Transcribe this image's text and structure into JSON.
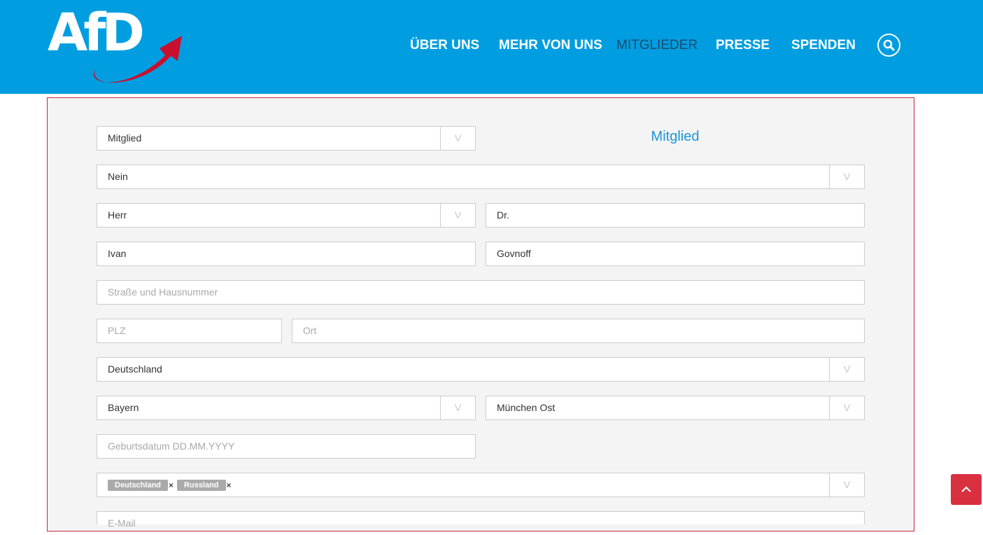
{
  "header": {
    "logo_text": "AfD",
    "nav": [
      {
        "label": "ÜBER UNS"
      },
      {
        "label": "MEHR VON UNS"
      },
      {
        "label": "MITGLIEDER"
      },
      {
        "label": "PRESSE"
      },
      {
        "label": "SPENDEN"
      }
    ],
    "search_icon": "search-icon"
  },
  "form": {
    "section_title": "Mitglied",
    "membership_type": {
      "value": "Mitglied"
    },
    "previously_member": {
      "value": "Nein"
    },
    "salutation": {
      "value": "Herr"
    },
    "title": {
      "value": "Dr."
    },
    "first_name": {
      "value": "Ivan"
    },
    "last_name": {
      "value": "Govnoff"
    },
    "street": {
      "placeholder": "Straße und Hausnummer"
    },
    "zip": {
      "placeholder": "PLZ"
    },
    "city": {
      "placeholder": "Ort"
    },
    "country": {
      "value": "Deutschland"
    },
    "state": {
      "value": "Bayern"
    },
    "district": {
      "value": "München Ost"
    },
    "birthdate": {
      "placeholder": "Geburtsdatum DD.MM.YYYY"
    },
    "citizenship": {
      "tags": [
        "Deutschland",
        "Russland"
      ],
      "remove_symbol": "×"
    },
    "email": {
      "placeholder": "E-Mail"
    },
    "dropdown_arrow": "V"
  },
  "colors": {
    "header_bg": "#009ee0",
    "accent_red": "#c5283b",
    "title_blue": "#1a96d6"
  }
}
